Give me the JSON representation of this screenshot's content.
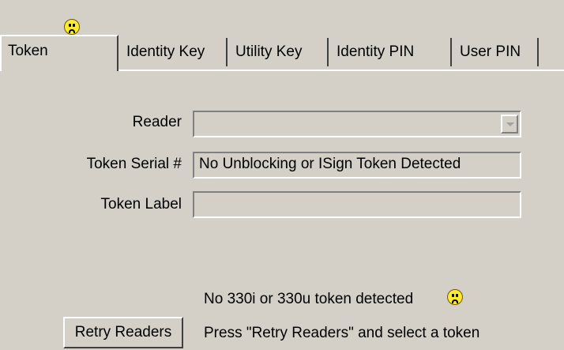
{
  "tabs": [
    {
      "label": "Token",
      "active": true,
      "status_icon": "sad-face-icon"
    },
    {
      "label": "Identity Key"
    },
    {
      "label": "Utility Key"
    },
    {
      "label": "Identity PIN"
    },
    {
      "label": "User PIN"
    }
  ],
  "form": {
    "reader_label": "Reader",
    "reader_value": "",
    "serial_label": "Token Serial #",
    "serial_value": "No Unblocking or ISign Token Detected",
    "token_label_label": "Token Label",
    "token_label_value": ""
  },
  "status": {
    "detected_text": "No 330i or 330u token detected",
    "detected_icon": "sad-face-icon",
    "instruction_text": "Press \"Retry Readers\" and select a token"
  },
  "buttons": {
    "retry_label": "Retry Readers"
  },
  "colors": {
    "background": "#d4d0c8",
    "face": "#ffeb2e"
  }
}
